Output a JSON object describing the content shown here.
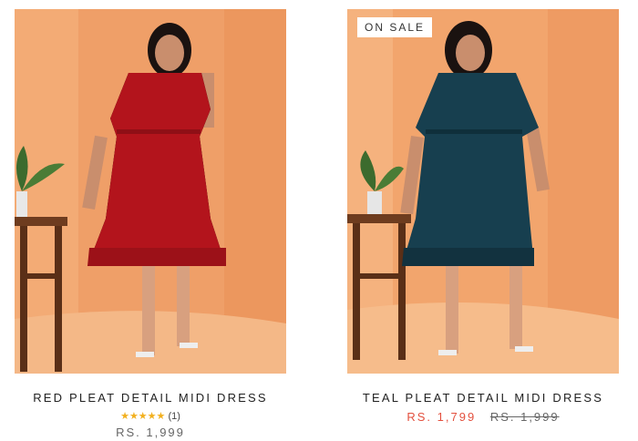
{
  "products": [
    {
      "title": "RED PLEAT DETAIL MIDI DRESS",
      "rating": {
        "stars": "★★★★★",
        "count": "(1)"
      },
      "price": "RS. 1,999",
      "dress_color": "#b3141c"
    },
    {
      "badge": "ON SALE",
      "title": "TEAL PLEAT DETAIL MIDI DRESS",
      "sale_price": "RS. 1,799",
      "original_price": "RS. 1,999",
      "dress_color": "#173f4f"
    }
  ],
  "colors": {
    "sale": "#e3503e",
    "star": "#f2b01e",
    "backdrop": "#f2a56d"
  }
}
